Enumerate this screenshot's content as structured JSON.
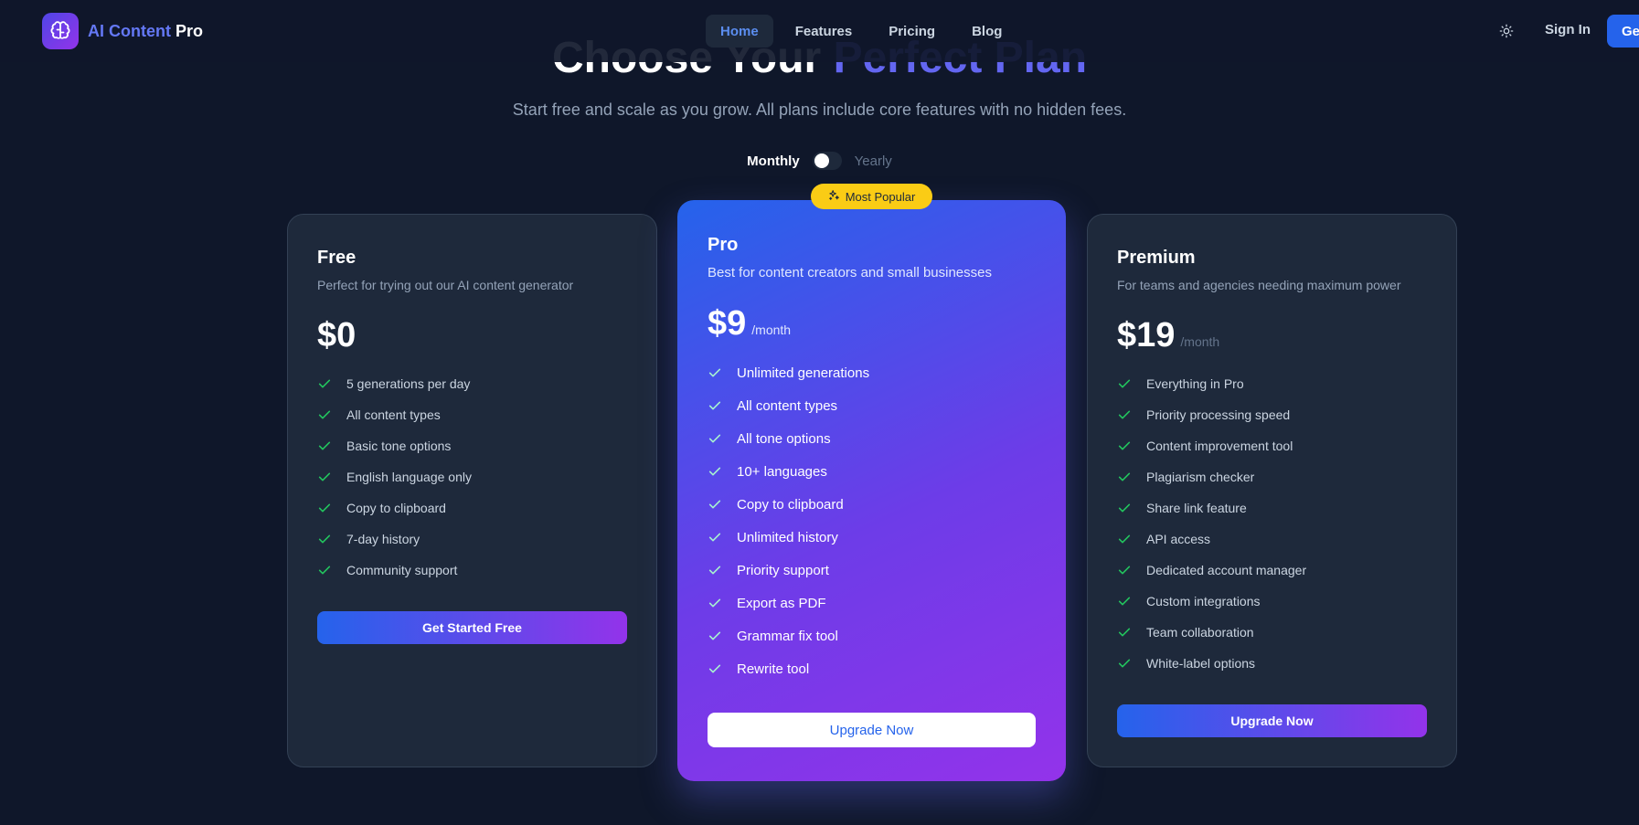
{
  "nav": {
    "logo_part1": "AI Content",
    "logo_part2": "Pro",
    "links": [
      {
        "label": "Home",
        "active": true
      },
      {
        "label": "Features"
      },
      {
        "label": "Pricing"
      },
      {
        "label": "Blog"
      }
    ],
    "theme_icon": "sun-icon",
    "sign_in": "Sign In",
    "get_started": "Get"
  },
  "hero": {
    "title_part1": "Choose Your ",
    "title_part2": "Perfect Plan",
    "subtitle": "Start free and scale as you grow. All plans include core features with no hidden fees."
  },
  "billing": {
    "monthly": "Monthly",
    "yearly": "Yearly",
    "selected": "Monthly"
  },
  "plans": [
    {
      "name": "Free",
      "description": "Perfect for trying out our AI content generator",
      "price": "$0",
      "period": "",
      "features": [
        "5 generations per day",
        "All content types",
        "Basic tone options",
        "English language only",
        "Copy to clipboard",
        "7-day history",
        "Community support"
      ],
      "cta": "Get Started Free"
    },
    {
      "name": "Pro",
      "badge": "Most Popular",
      "description": "Best for content creators and small businesses",
      "price": "$9",
      "period": "/month",
      "features": [
        "Unlimited generations",
        "All content types",
        "All tone options",
        "10+ languages",
        "Copy to clipboard",
        "Unlimited history",
        "Priority support",
        "Export as PDF",
        "Grammar fix tool",
        "Rewrite tool"
      ],
      "cta": "Upgrade Now"
    },
    {
      "name": "Premium",
      "description": "For teams and agencies needing maximum power",
      "price": "$19",
      "period": "/month",
      "features": [
        "Everything in Pro",
        "Priority processing speed",
        "Content improvement tool",
        "Plagiarism checker",
        "Share link feature",
        "API access",
        "Dedicated account manager",
        "Custom integrations",
        "Team collaboration",
        "White-label options"
      ],
      "cta": "Upgrade Now"
    }
  ],
  "colors": {
    "background": "#0f172a",
    "card": "#1e293b",
    "accent": "#2563eb",
    "accent_purple": "#9333ea",
    "check": "#22c55e",
    "badge": "#facc15"
  }
}
